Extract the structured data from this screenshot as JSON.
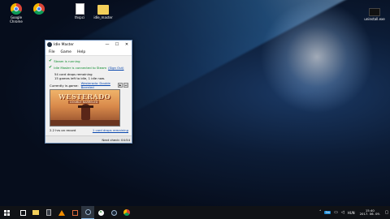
{
  "desktop": {
    "icons": [
      {
        "label": "Google Chrome",
        "type": "chrome"
      },
      {
        "label": "",
        "type": "chrome"
      },
      {
        "label": "thspci",
        "type": "file"
      },
      {
        "label": "idle_master",
        "type": "folder"
      }
    ],
    "corner_app_label": "uninstall.exe"
  },
  "window": {
    "title": "Idle Master",
    "controls": {
      "minimize": "—",
      "maximize": "☐",
      "close": "✕"
    },
    "menu": [
      "File",
      "Game",
      "Help"
    ],
    "status": {
      "steam_running": "Steam is running",
      "connected": "Idle Master is connected to Steam",
      "sign_out": "(Sign Out)"
    },
    "drops_remaining": "54 card drops remaining",
    "games_left": "15 games left to idle, 1 idle now.",
    "currently_label": "Currently in-game:",
    "current_game": "Westerado: Double Barreled",
    "mini_buttons": [
      "▶",
      "⏭"
    ],
    "art": {
      "title": "WESTERADO",
      "subtitle": "DOUBLE BARRELED"
    },
    "time_on_record": "2.2 hrs on record",
    "card_drops_link": "1 card drops remaining",
    "next_check": "Next check: 04:54"
  },
  "taskbar": {
    "tray_language": "HUN",
    "tray_badge": "5m",
    "clock_time": "15:40",
    "clock_date": "2017. 06. 09."
  }
}
